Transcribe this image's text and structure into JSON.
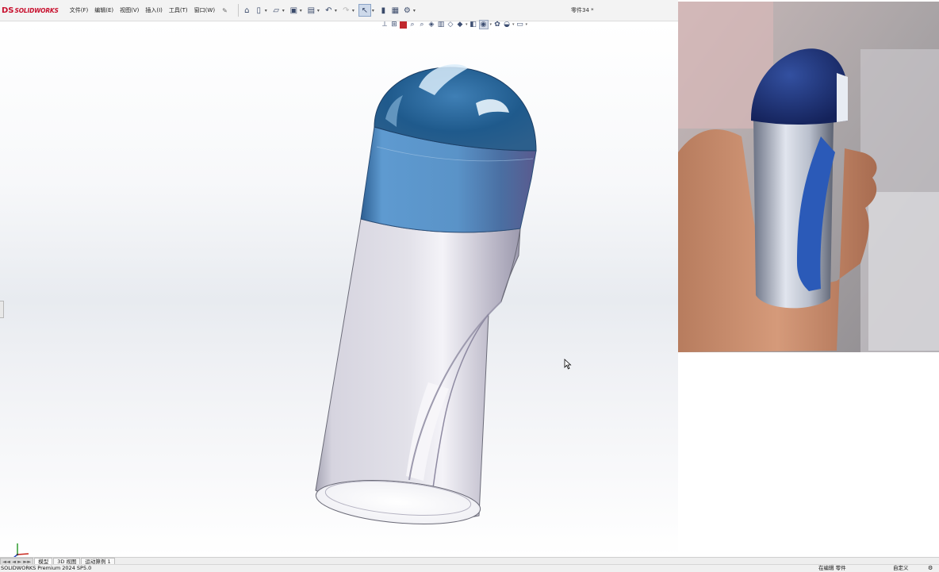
{
  "app": {
    "logo_mark": "DS",
    "logo_text": "SOLIDWORKS",
    "document_title": "零件34 *"
  },
  "menu": {
    "items": [
      {
        "label": "文件(F)"
      },
      {
        "label": "编辑(E)"
      },
      {
        "label": "视图(V)"
      },
      {
        "label": "插入(I)"
      },
      {
        "label": "工具(T)"
      },
      {
        "label": "窗口(W)"
      }
    ]
  },
  "toolbar": {
    "icons": [
      "home-icon",
      "new-document-icon",
      "open-folder-icon",
      "save-icon",
      "print-icon",
      "undo-icon",
      "redo-icon",
      "select-cursor-icon",
      "rebuild-traffic-light-icon",
      "file-properties-icon",
      "options-gear-icon"
    ]
  },
  "viewbar": {
    "icons": [
      "zoom-to-fit-icon",
      "zoom-area-icon",
      "previous-view-icon",
      "section-view-icon",
      "dynamic-annotation-icon",
      "view-orientation-icon",
      "display-style-icon",
      "hide-show-items-icon",
      "edit-appearance-icon",
      "apply-scene-icon",
      "view-settings-icon",
      "display-monitor-icon"
    ]
  },
  "bottom_tabs": {
    "nav_label": "◄◄ ◄ ► ►►",
    "tabs": [
      {
        "label": "模型"
      },
      {
        "label": "3D 视图"
      },
      {
        "label": "运动算例 1"
      }
    ]
  },
  "status": {
    "product": "SOLIDWORKS Premium 2024 SP5.0",
    "mode": "在编辑 零件",
    "units": "自定义",
    "icon": "help-icon"
  },
  "colors": {
    "cap_blue": "#2e6a9c",
    "collar_blue": "#4f8ec4",
    "glass_body": "#d4d2dd",
    "logo_red": "#c8102e",
    "photo_cap_navy": "#1d2e66"
  }
}
